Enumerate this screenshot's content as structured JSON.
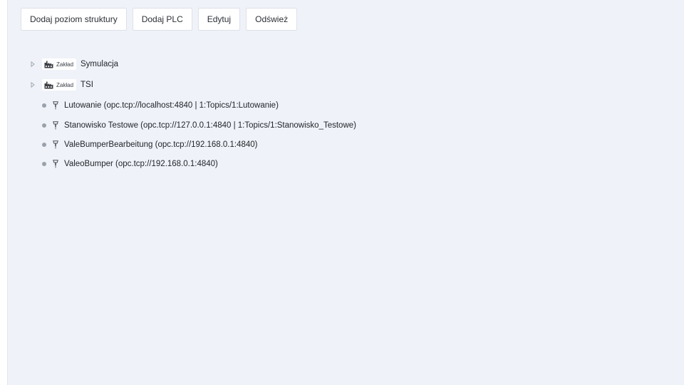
{
  "toolbar": {
    "buttons": [
      {
        "label": "Dodaj poziom struktury"
      },
      {
        "label": "Dodaj PLC"
      },
      {
        "label": "Edytuj"
      },
      {
        "label": "Odśwież"
      }
    ]
  },
  "tree": {
    "levels": [
      {
        "badge": "Zakład",
        "name": "Symulacja",
        "icon": "factory-icon"
      },
      {
        "badge": "Zakład",
        "name": "TSI",
        "icon": "factory-icon"
      }
    ],
    "plcs": [
      {
        "label": "Lutowanie (opc.tcp://localhost:4840 | 1:Topics/1:Lutowanie)",
        "icon": "plc-icon"
      },
      {
        "label": "Stanowisko Testowe (opc.tcp://127.0.0.1:4840 | 1:Topics/1:Stanowisko_Testowe)",
        "icon": "plc-icon"
      },
      {
        "label": "ValeBumperBearbeitung (opc.tcp://192.168.0.1:4840)",
        "icon": "plc-icon"
      },
      {
        "label": "ValeoBumper (opc.tcp://192.168.0.1:4840)",
        "icon": "plc-icon"
      }
    ]
  }
}
